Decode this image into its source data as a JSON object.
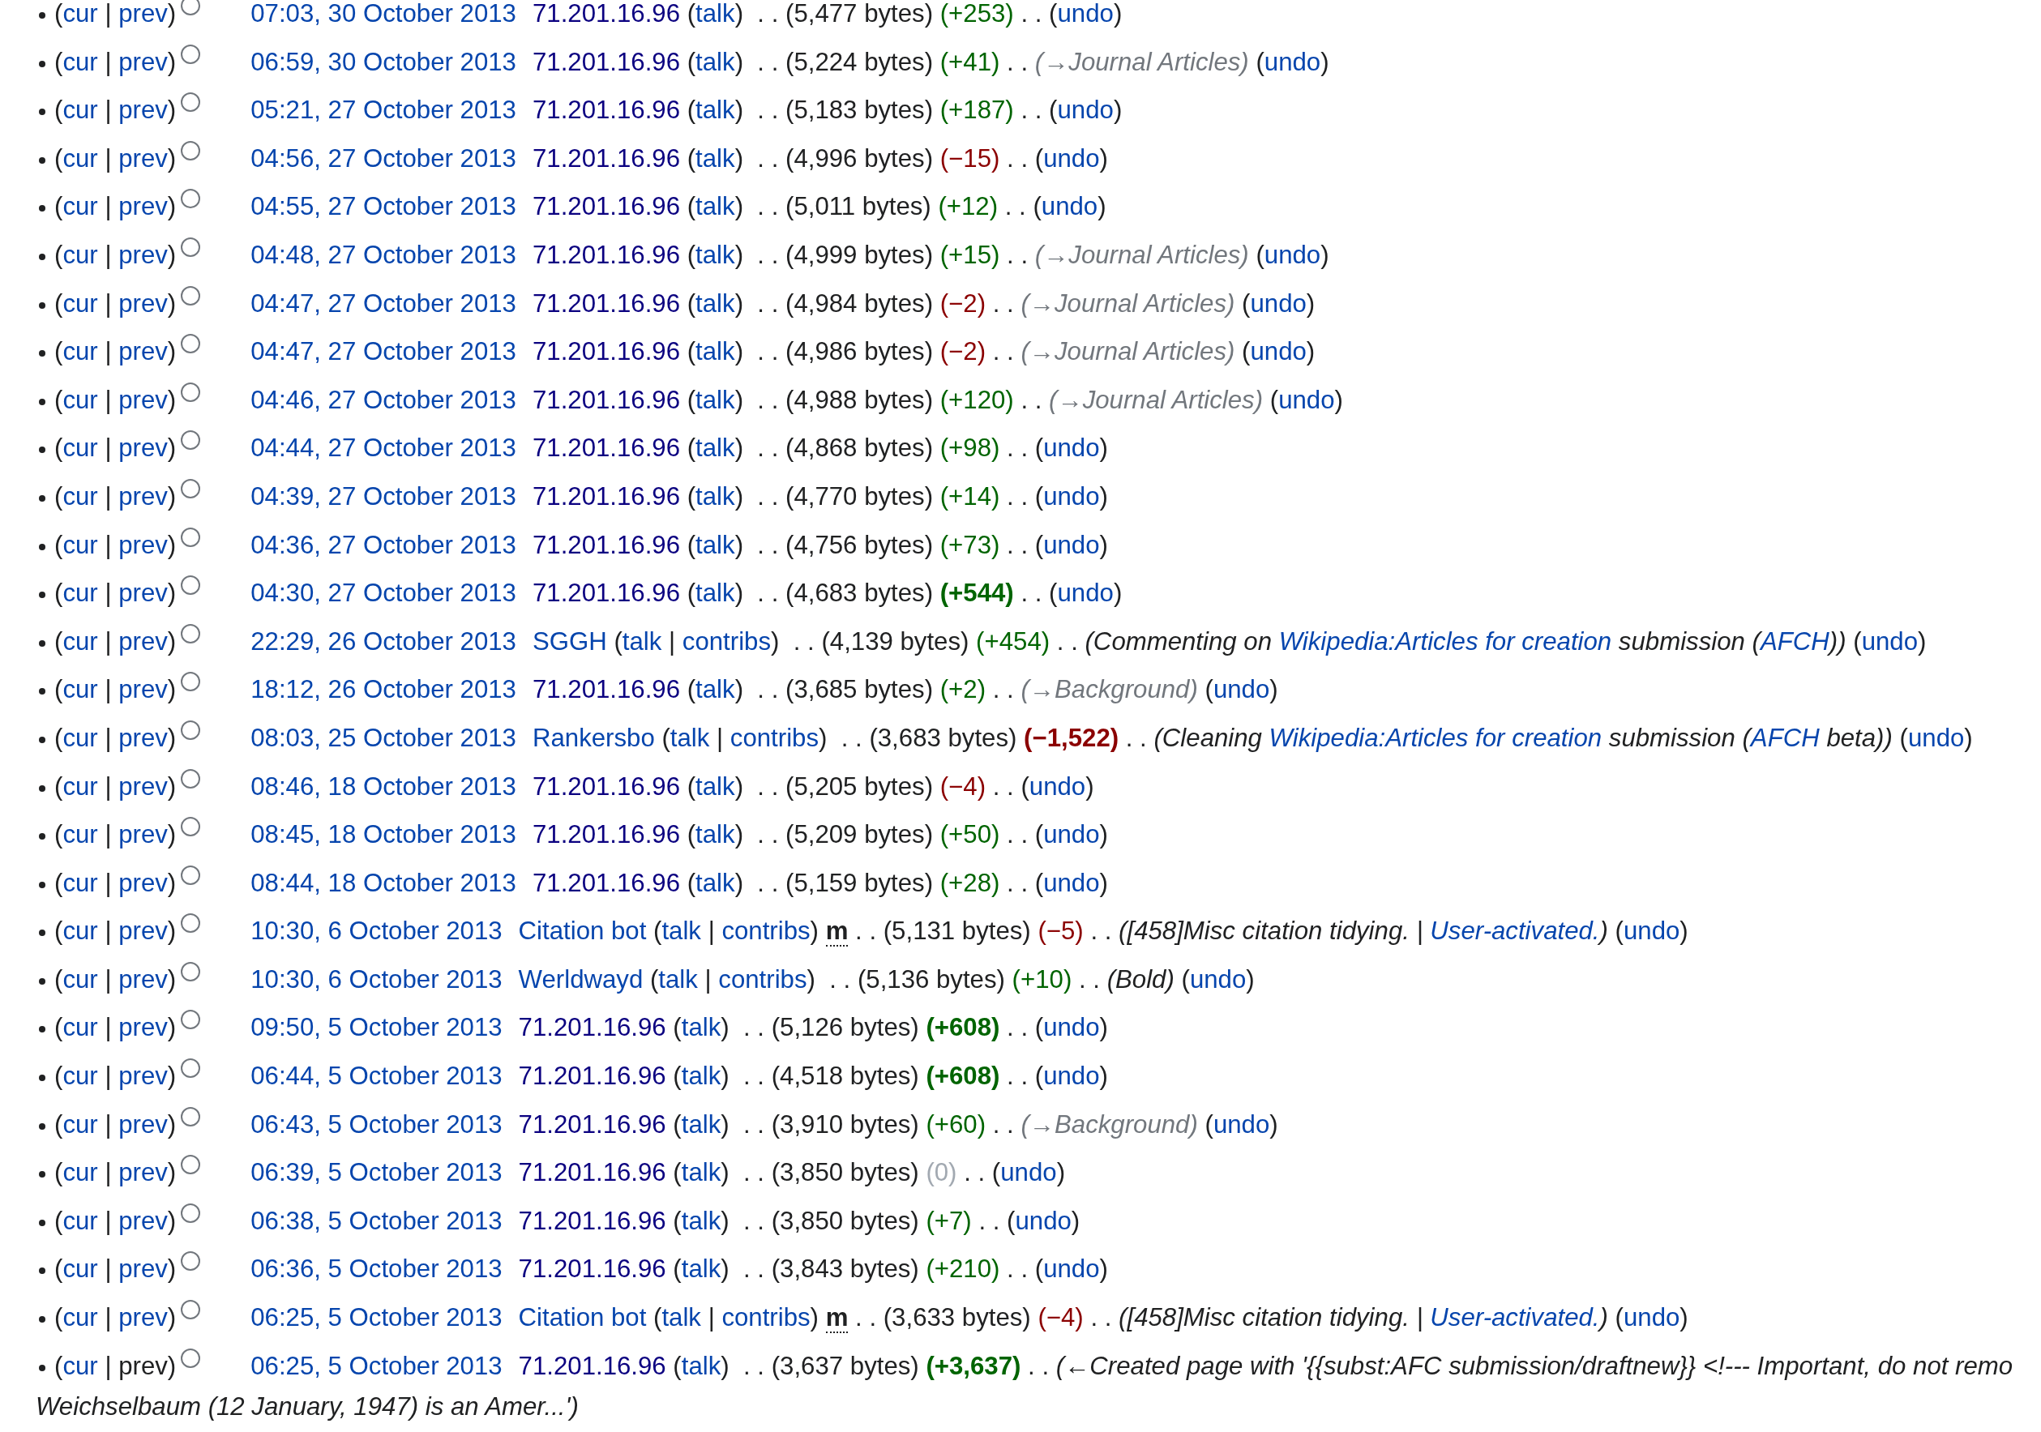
{
  "rows": [
    {
      "selected": false,
      "lead": [
        {
          "kind": "p",
          "text": "("
        },
        {
          "kind": "l",
          "text": "cur"
        },
        {
          "kind": "p",
          "text": " | "
        },
        {
          "kind": "l",
          "text": "prev"
        },
        {
          "kind": "p",
          "text": ")"
        }
      ],
      "parts": [
        {
          "kind": "d",
          "text": "07:03, 30 October 2013"
        },
        {
          "kind": "v",
          "text": "71.201.16.96"
        },
        {
          "kind": "p",
          "text": " ("
        },
        {
          "kind": "l",
          "text": "talk"
        },
        {
          "kind": "p",
          "text": ")  . . (5,477 bytes) "
        },
        {
          "kind": "dp",
          "text": "(+253)"
        },
        {
          "kind": "p",
          "text": " . . ("
        },
        {
          "kind": "l",
          "text": "undo"
        },
        {
          "kind": "p",
          "text": ")"
        }
      ]
    },
    {
      "selected": false,
      "lead": [
        {
          "kind": "p",
          "text": "("
        },
        {
          "kind": "l",
          "text": "cur"
        },
        {
          "kind": "p",
          "text": " | "
        },
        {
          "kind": "l",
          "text": "prev"
        },
        {
          "kind": "p",
          "text": ")"
        }
      ],
      "parts": [
        {
          "kind": "d",
          "text": "06:59, 30 October 2013"
        },
        {
          "kind": "v",
          "text": "71.201.16.96"
        },
        {
          "kind": "p",
          "text": " ("
        },
        {
          "kind": "l",
          "text": "talk"
        },
        {
          "kind": "p",
          "text": ")  . . (5,224 bytes) "
        },
        {
          "kind": "dp",
          "text": "(+41)"
        },
        {
          "kind": "p",
          "text": " . . "
        },
        {
          "kind": "s",
          "text": "(→Journal Articles)"
        },
        {
          "kind": "p",
          "text": " ("
        },
        {
          "kind": "l",
          "text": "undo"
        },
        {
          "kind": "p",
          "text": ")"
        }
      ]
    },
    {
      "selected": false,
      "lead": [
        {
          "kind": "p",
          "text": "("
        },
        {
          "kind": "l",
          "text": "cur"
        },
        {
          "kind": "p",
          "text": " | "
        },
        {
          "kind": "l",
          "text": "prev"
        },
        {
          "kind": "p",
          "text": ")"
        }
      ],
      "parts": [
        {
          "kind": "d",
          "text": "05:21, 27 October 2013"
        },
        {
          "kind": "v",
          "text": "71.201.16.96"
        },
        {
          "kind": "p",
          "text": " ("
        },
        {
          "kind": "l",
          "text": "talk"
        },
        {
          "kind": "p",
          "text": ")  . . (5,183 bytes) "
        },
        {
          "kind": "dp",
          "text": "(+187)"
        },
        {
          "kind": "p",
          "text": " . . ("
        },
        {
          "kind": "l",
          "text": "undo"
        },
        {
          "kind": "p",
          "text": ")"
        }
      ]
    },
    {
      "selected": false,
      "lead": [
        {
          "kind": "p",
          "text": "("
        },
        {
          "kind": "l",
          "text": "cur"
        },
        {
          "kind": "p",
          "text": " | "
        },
        {
          "kind": "l",
          "text": "prev"
        },
        {
          "kind": "p",
          "text": ")"
        }
      ],
      "parts": [
        {
          "kind": "d",
          "text": "04:56, 27 October 2013"
        },
        {
          "kind": "v",
          "text": "71.201.16.96"
        },
        {
          "kind": "p",
          "text": " ("
        },
        {
          "kind": "l",
          "text": "talk"
        },
        {
          "kind": "p",
          "text": ")  . . (4,996 bytes) "
        },
        {
          "kind": "dn",
          "text": "(−15)"
        },
        {
          "kind": "p",
          "text": " . . ("
        },
        {
          "kind": "l",
          "text": "undo"
        },
        {
          "kind": "p",
          "text": ")"
        }
      ]
    },
    {
      "selected": false,
      "lead": [
        {
          "kind": "p",
          "text": "("
        },
        {
          "kind": "l",
          "text": "cur"
        },
        {
          "kind": "p",
          "text": " | "
        },
        {
          "kind": "l",
          "text": "prev"
        },
        {
          "kind": "p",
          "text": ")"
        }
      ],
      "parts": [
        {
          "kind": "d",
          "text": "04:55, 27 October 2013"
        },
        {
          "kind": "v",
          "text": "71.201.16.96"
        },
        {
          "kind": "p",
          "text": " ("
        },
        {
          "kind": "l",
          "text": "talk"
        },
        {
          "kind": "p",
          "text": ")  . . (5,011 bytes) "
        },
        {
          "kind": "dp",
          "text": "(+12)"
        },
        {
          "kind": "p",
          "text": " . . ("
        },
        {
          "kind": "l",
          "text": "undo"
        },
        {
          "kind": "p",
          "text": ")"
        }
      ]
    },
    {
      "selected": false,
      "lead": [
        {
          "kind": "p",
          "text": "("
        },
        {
          "kind": "l",
          "text": "cur"
        },
        {
          "kind": "p",
          "text": " | "
        },
        {
          "kind": "l",
          "text": "prev"
        },
        {
          "kind": "p",
          "text": ")"
        }
      ],
      "parts": [
        {
          "kind": "d",
          "text": "04:48, 27 October 2013"
        },
        {
          "kind": "v",
          "text": "71.201.16.96"
        },
        {
          "kind": "p",
          "text": " ("
        },
        {
          "kind": "l",
          "text": "talk"
        },
        {
          "kind": "p",
          "text": ")  . . (4,999 bytes) "
        },
        {
          "kind": "dp",
          "text": "(+15)"
        },
        {
          "kind": "p",
          "text": " . . "
        },
        {
          "kind": "s",
          "text": "(→Journal Articles)"
        },
        {
          "kind": "p",
          "text": " ("
        },
        {
          "kind": "l",
          "text": "undo"
        },
        {
          "kind": "p",
          "text": ")"
        }
      ]
    },
    {
      "selected": false,
      "lead": [
        {
          "kind": "p",
          "text": "("
        },
        {
          "kind": "l",
          "text": "cur"
        },
        {
          "kind": "p",
          "text": " | "
        },
        {
          "kind": "l",
          "text": "prev"
        },
        {
          "kind": "p",
          "text": ")"
        }
      ],
      "parts": [
        {
          "kind": "d",
          "text": "04:47, 27 October 2013"
        },
        {
          "kind": "v",
          "text": "71.201.16.96"
        },
        {
          "kind": "p",
          "text": " ("
        },
        {
          "kind": "l",
          "text": "talk"
        },
        {
          "kind": "p",
          "text": ")  . . (4,984 bytes) "
        },
        {
          "kind": "dn",
          "text": "(−2)"
        },
        {
          "kind": "p",
          "text": " . . "
        },
        {
          "kind": "s",
          "text": "(→Journal Articles)"
        },
        {
          "kind": "p",
          "text": " ("
        },
        {
          "kind": "l",
          "text": "undo"
        },
        {
          "kind": "p",
          "text": ")"
        }
      ]
    },
    {
      "selected": false,
      "lead": [
        {
          "kind": "p",
          "text": "("
        },
        {
          "kind": "l",
          "text": "cur"
        },
        {
          "kind": "p",
          "text": " | "
        },
        {
          "kind": "l",
          "text": "prev"
        },
        {
          "kind": "p",
          "text": ")"
        }
      ],
      "parts": [
        {
          "kind": "d",
          "text": "04:47, 27 October 2013"
        },
        {
          "kind": "v",
          "text": "71.201.16.96"
        },
        {
          "kind": "p",
          "text": " ("
        },
        {
          "kind": "l",
          "text": "talk"
        },
        {
          "kind": "p",
          "text": ")  . . (4,986 bytes) "
        },
        {
          "kind": "dn",
          "text": "(−2)"
        },
        {
          "kind": "p",
          "text": " . . "
        },
        {
          "kind": "s",
          "text": "(→Journal Articles)"
        },
        {
          "kind": "p",
          "text": " ("
        },
        {
          "kind": "l",
          "text": "undo"
        },
        {
          "kind": "p",
          "text": ")"
        }
      ]
    },
    {
      "selected": false,
      "lead": [
        {
          "kind": "p",
          "text": "("
        },
        {
          "kind": "l",
          "text": "cur"
        },
        {
          "kind": "p",
          "text": " | "
        },
        {
          "kind": "l",
          "text": "prev"
        },
        {
          "kind": "p",
          "text": ")"
        }
      ],
      "parts": [
        {
          "kind": "d",
          "text": "04:46, 27 October 2013"
        },
        {
          "kind": "v",
          "text": "71.201.16.96"
        },
        {
          "kind": "p",
          "text": " ("
        },
        {
          "kind": "l",
          "text": "talk"
        },
        {
          "kind": "p",
          "text": ")  . . (4,988 bytes) "
        },
        {
          "kind": "dp",
          "text": "(+120)"
        },
        {
          "kind": "p",
          "text": " . . "
        },
        {
          "kind": "s",
          "text": "(→Journal Articles)"
        },
        {
          "kind": "p",
          "text": " ("
        },
        {
          "kind": "l",
          "text": "undo"
        },
        {
          "kind": "p",
          "text": ")"
        }
      ]
    },
    {
      "selected": false,
      "lead": [
        {
          "kind": "p",
          "text": "("
        },
        {
          "kind": "l",
          "text": "cur"
        },
        {
          "kind": "p",
          "text": " | "
        },
        {
          "kind": "l",
          "text": "prev"
        },
        {
          "kind": "p",
          "text": ")"
        }
      ],
      "parts": [
        {
          "kind": "d",
          "text": "04:44, 27 October 2013"
        },
        {
          "kind": "v",
          "text": "71.201.16.96"
        },
        {
          "kind": "p",
          "text": " ("
        },
        {
          "kind": "l",
          "text": "talk"
        },
        {
          "kind": "p",
          "text": ")  . . (4,868 bytes) "
        },
        {
          "kind": "dp",
          "text": "(+98)"
        },
        {
          "kind": "p",
          "text": " . . ("
        },
        {
          "kind": "l",
          "text": "undo"
        },
        {
          "kind": "p",
          "text": ")"
        }
      ]
    },
    {
      "selected": false,
      "lead": [
        {
          "kind": "p",
          "text": "("
        },
        {
          "kind": "l",
          "text": "cur"
        },
        {
          "kind": "p",
          "text": " | "
        },
        {
          "kind": "l",
          "text": "prev"
        },
        {
          "kind": "p",
          "text": ")"
        }
      ],
      "parts": [
        {
          "kind": "d",
          "text": "04:39, 27 October 2013"
        },
        {
          "kind": "v",
          "text": "71.201.16.96"
        },
        {
          "kind": "p",
          "text": " ("
        },
        {
          "kind": "l",
          "text": "talk"
        },
        {
          "kind": "p",
          "text": ")  . . (4,770 bytes) "
        },
        {
          "kind": "dp",
          "text": "(+14)"
        },
        {
          "kind": "p",
          "text": " . . ("
        },
        {
          "kind": "l",
          "text": "undo"
        },
        {
          "kind": "p",
          "text": ")"
        }
      ]
    },
    {
      "selected": false,
      "lead": [
        {
          "kind": "p",
          "text": "("
        },
        {
          "kind": "l",
          "text": "cur"
        },
        {
          "kind": "p",
          "text": " | "
        },
        {
          "kind": "l",
          "text": "prev"
        },
        {
          "kind": "p",
          "text": ")"
        }
      ],
      "parts": [
        {
          "kind": "d",
          "text": "04:36, 27 October 2013"
        },
        {
          "kind": "v",
          "text": "71.201.16.96"
        },
        {
          "kind": "p",
          "text": " ("
        },
        {
          "kind": "l",
          "text": "talk"
        },
        {
          "kind": "p",
          "text": ")  . . (4,756 bytes) "
        },
        {
          "kind": "dp",
          "text": "(+73)"
        },
        {
          "kind": "p",
          "text": " . . ("
        },
        {
          "kind": "l",
          "text": "undo"
        },
        {
          "kind": "p",
          "text": ")"
        }
      ]
    },
    {
      "selected": false,
      "lead": [
        {
          "kind": "p",
          "text": "("
        },
        {
          "kind": "l",
          "text": "cur"
        },
        {
          "kind": "p",
          "text": " | "
        },
        {
          "kind": "l",
          "text": "prev"
        },
        {
          "kind": "p",
          "text": ")"
        }
      ],
      "parts": [
        {
          "kind": "d",
          "text": "04:30, 27 October 2013"
        },
        {
          "kind": "v",
          "text": "71.201.16.96"
        },
        {
          "kind": "p",
          "text": " ("
        },
        {
          "kind": "l",
          "text": "talk"
        },
        {
          "kind": "p",
          "text": ")  . . (4,683 bytes) "
        },
        {
          "kind": "dpb",
          "text": "(+544)"
        },
        {
          "kind": "p",
          "text": " . . ("
        },
        {
          "kind": "l",
          "text": "undo"
        },
        {
          "kind": "p",
          "text": ")"
        }
      ]
    },
    {
      "selected": false,
      "lead": [
        {
          "kind": "p",
          "text": "("
        },
        {
          "kind": "l",
          "text": "cur"
        },
        {
          "kind": "p",
          "text": " | "
        },
        {
          "kind": "l",
          "text": "prev"
        },
        {
          "kind": "p",
          "text": ")"
        }
      ],
      "parts": [
        {
          "kind": "d",
          "text": "22:29, 26 October 2013"
        },
        {
          "kind": "l",
          "text": "SGGH"
        },
        {
          "kind": "p",
          "text": " ("
        },
        {
          "kind": "l",
          "text": "talk"
        },
        {
          "kind": "p",
          "text": " | "
        },
        {
          "kind": "l",
          "text": "contribs"
        },
        {
          "kind": "p",
          "text": ")  . . (4,139 bytes) "
        },
        {
          "kind": "dp",
          "text": "(+454)"
        },
        {
          "kind": "p",
          "text": " . . "
        },
        {
          "kind": "i",
          "text": "(Commenting on "
        },
        {
          "kind": "il",
          "text": "Wikipedia:Articles for creation"
        },
        {
          "kind": "i",
          "text": " submission ("
        },
        {
          "kind": "il",
          "text": "AFCH"
        },
        {
          "kind": "i",
          "text": "))"
        },
        {
          "kind": "p",
          "text": " ("
        },
        {
          "kind": "l",
          "text": "undo"
        },
        {
          "kind": "p",
          "text": ")"
        }
      ]
    },
    {
      "selected": false,
      "lead": [
        {
          "kind": "p",
          "text": "("
        },
        {
          "kind": "l",
          "text": "cur"
        },
        {
          "kind": "p",
          "text": " | "
        },
        {
          "kind": "l",
          "text": "prev"
        },
        {
          "kind": "p",
          "text": ")"
        }
      ],
      "parts": [
        {
          "kind": "d",
          "text": "18:12, 26 October 2013"
        },
        {
          "kind": "v",
          "text": "71.201.16.96"
        },
        {
          "kind": "p",
          "text": " ("
        },
        {
          "kind": "l",
          "text": "talk"
        },
        {
          "kind": "p",
          "text": ")  . . (3,685 bytes) "
        },
        {
          "kind": "dp",
          "text": "(+2)"
        },
        {
          "kind": "p",
          "text": " . . "
        },
        {
          "kind": "s",
          "text": "(→Background)"
        },
        {
          "kind": "p",
          "text": " ("
        },
        {
          "kind": "l",
          "text": "undo"
        },
        {
          "kind": "p",
          "text": ")"
        }
      ]
    },
    {
      "selected": false,
      "lead": [
        {
          "kind": "p",
          "text": "("
        },
        {
          "kind": "l",
          "text": "cur"
        },
        {
          "kind": "p",
          "text": " | "
        },
        {
          "kind": "l",
          "text": "prev"
        },
        {
          "kind": "p",
          "text": ")"
        }
      ],
      "parts": [
        {
          "kind": "d",
          "text": "08:03, 25 October 2013"
        },
        {
          "kind": "l",
          "text": "Rankersbo"
        },
        {
          "kind": "p",
          "text": " ("
        },
        {
          "kind": "l",
          "text": "talk"
        },
        {
          "kind": "p",
          "text": " | "
        },
        {
          "kind": "l",
          "text": "contribs"
        },
        {
          "kind": "p",
          "text": ")  . . (3,683 bytes) "
        },
        {
          "kind": "dnb",
          "text": "(−1,522)"
        },
        {
          "kind": "p",
          "text": " . . "
        },
        {
          "kind": "i",
          "text": "(Cleaning "
        },
        {
          "kind": "il",
          "text": "Wikipedia:Articles for creation"
        },
        {
          "kind": "i",
          "text": " submission ("
        },
        {
          "kind": "il",
          "text": "AFCH"
        },
        {
          "kind": "i",
          "text": " beta))"
        },
        {
          "kind": "p",
          "text": " ("
        },
        {
          "kind": "l",
          "text": "undo"
        },
        {
          "kind": "p",
          "text": ")"
        }
      ]
    },
    {
      "selected": false,
      "lead": [
        {
          "kind": "p",
          "text": "("
        },
        {
          "kind": "l",
          "text": "cur"
        },
        {
          "kind": "p",
          "text": " | "
        },
        {
          "kind": "l",
          "text": "prev"
        },
        {
          "kind": "p",
          "text": ")"
        }
      ],
      "parts": [
        {
          "kind": "d",
          "text": "08:46, 18 October 2013"
        },
        {
          "kind": "v",
          "text": "71.201.16.96"
        },
        {
          "kind": "p",
          "text": " ("
        },
        {
          "kind": "l",
          "text": "talk"
        },
        {
          "kind": "p",
          "text": ")  . . (5,205 bytes) "
        },
        {
          "kind": "dn",
          "text": "(−4)"
        },
        {
          "kind": "p",
          "text": " . . ("
        },
        {
          "kind": "l",
          "text": "undo"
        },
        {
          "kind": "p",
          "text": ")"
        }
      ]
    },
    {
      "selected": false,
      "lead": [
        {
          "kind": "p",
          "text": "("
        },
        {
          "kind": "l",
          "text": "cur"
        },
        {
          "kind": "p",
          "text": " | "
        },
        {
          "kind": "l",
          "text": "prev"
        },
        {
          "kind": "p",
          "text": ")"
        }
      ],
      "parts": [
        {
          "kind": "d",
          "text": "08:45, 18 October 2013"
        },
        {
          "kind": "v",
          "text": "71.201.16.96"
        },
        {
          "kind": "p",
          "text": " ("
        },
        {
          "kind": "l",
          "text": "talk"
        },
        {
          "kind": "p",
          "text": ")  . . (5,209 bytes) "
        },
        {
          "kind": "dp",
          "text": "(+50)"
        },
        {
          "kind": "p",
          "text": " . . ("
        },
        {
          "kind": "l",
          "text": "undo"
        },
        {
          "kind": "p",
          "text": ")"
        }
      ]
    },
    {
      "selected": false,
      "lead": [
        {
          "kind": "p",
          "text": "("
        },
        {
          "kind": "l",
          "text": "cur"
        },
        {
          "kind": "p",
          "text": " | "
        },
        {
          "kind": "l",
          "text": "prev"
        },
        {
          "kind": "p",
          "text": ")"
        }
      ],
      "parts": [
        {
          "kind": "d",
          "text": "08:44, 18 October 2013"
        },
        {
          "kind": "v",
          "text": "71.201.16.96"
        },
        {
          "kind": "p",
          "text": " ("
        },
        {
          "kind": "l",
          "text": "talk"
        },
        {
          "kind": "p",
          "text": ")  . . (5,159 bytes) "
        },
        {
          "kind": "dp",
          "text": "(+28)"
        },
        {
          "kind": "p",
          "text": " . . ("
        },
        {
          "kind": "l",
          "text": "undo"
        },
        {
          "kind": "p",
          "text": ")"
        }
      ]
    },
    {
      "selected": false,
      "lead": [
        {
          "kind": "p",
          "text": "("
        },
        {
          "kind": "l",
          "text": "cur"
        },
        {
          "kind": "p",
          "text": " | "
        },
        {
          "kind": "l",
          "text": "prev"
        },
        {
          "kind": "p",
          "text": ")"
        }
      ],
      "parts": [
        {
          "kind": "d",
          "text": "10:30, 6 October 2013"
        },
        {
          "kind": "l",
          "text": "Citation bot"
        },
        {
          "kind": "p",
          "text": " ("
        },
        {
          "kind": "l",
          "text": "talk"
        },
        {
          "kind": "p",
          "text": " | "
        },
        {
          "kind": "l",
          "text": "contribs"
        },
        {
          "kind": "p",
          "text": ") "
        },
        {
          "kind": "m",
          "text": "m"
        },
        {
          "kind": "p",
          "text": " . . (5,131 bytes) "
        },
        {
          "kind": "dn",
          "text": "(−5)"
        },
        {
          "kind": "p",
          "text": " . . "
        },
        {
          "kind": "i",
          "text": "([458]Misc citation tidying. | "
        },
        {
          "kind": "il",
          "text": "User-activated."
        },
        {
          "kind": "i",
          "text": ")"
        },
        {
          "kind": "p",
          "text": " ("
        },
        {
          "kind": "l",
          "text": "undo"
        },
        {
          "kind": "p",
          "text": ")"
        }
      ]
    },
    {
      "selected": false,
      "lead": [
        {
          "kind": "p",
          "text": "("
        },
        {
          "kind": "l",
          "text": "cur"
        },
        {
          "kind": "p",
          "text": " | "
        },
        {
          "kind": "l",
          "text": "prev"
        },
        {
          "kind": "p",
          "text": ")"
        }
      ],
      "parts": [
        {
          "kind": "d",
          "text": "10:30, 6 October 2013"
        },
        {
          "kind": "l",
          "text": "Werldwayd"
        },
        {
          "kind": "p",
          "text": " ("
        },
        {
          "kind": "l",
          "text": "talk"
        },
        {
          "kind": "p",
          "text": " | "
        },
        {
          "kind": "l",
          "text": "contribs"
        },
        {
          "kind": "p",
          "text": ")  . . (5,136 bytes) "
        },
        {
          "kind": "dp",
          "text": "(+10)"
        },
        {
          "kind": "p",
          "text": " . . "
        },
        {
          "kind": "i",
          "text": "(Bold)"
        },
        {
          "kind": "p",
          "text": " ("
        },
        {
          "kind": "l",
          "text": "undo"
        },
        {
          "kind": "p",
          "text": ")"
        }
      ]
    },
    {
      "selected": false,
      "lead": [
        {
          "kind": "p",
          "text": "("
        },
        {
          "kind": "l",
          "text": "cur"
        },
        {
          "kind": "p",
          "text": " | "
        },
        {
          "kind": "l",
          "text": "prev"
        },
        {
          "kind": "p",
          "text": ")"
        }
      ],
      "parts": [
        {
          "kind": "d",
          "text": "09:50, 5 October 2013"
        },
        {
          "kind": "v",
          "text": "71.201.16.96"
        },
        {
          "kind": "p",
          "text": " ("
        },
        {
          "kind": "l",
          "text": "talk"
        },
        {
          "kind": "p",
          "text": ")  . . (5,126 bytes) "
        },
        {
          "kind": "dpb",
          "text": "(+608)"
        },
        {
          "kind": "p",
          "text": " . . ("
        },
        {
          "kind": "l",
          "text": "undo"
        },
        {
          "kind": "p",
          "text": ")"
        }
      ]
    },
    {
      "selected": false,
      "lead": [
        {
          "kind": "p",
          "text": "("
        },
        {
          "kind": "l",
          "text": "cur"
        },
        {
          "kind": "p",
          "text": " | "
        },
        {
          "kind": "l",
          "text": "prev"
        },
        {
          "kind": "p",
          "text": ")"
        }
      ],
      "parts": [
        {
          "kind": "d",
          "text": "06:44, 5 October 2013"
        },
        {
          "kind": "v",
          "text": "71.201.16.96"
        },
        {
          "kind": "p",
          "text": " ("
        },
        {
          "kind": "l",
          "text": "talk"
        },
        {
          "kind": "p",
          "text": ")  . . (4,518 bytes) "
        },
        {
          "kind": "dpb",
          "text": "(+608)"
        },
        {
          "kind": "p",
          "text": " . . ("
        },
        {
          "kind": "l",
          "text": "undo"
        },
        {
          "kind": "p",
          "text": ")"
        }
      ]
    },
    {
      "selected": false,
      "lead": [
        {
          "kind": "p",
          "text": "("
        },
        {
          "kind": "l",
          "text": "cur"
        },
        {
          "kind": "p",
          "text": " | "
        },
        {
          "kind": "l",
          "text": "prev"
        },
        {
          "kind": "p",
          "text": ")"
        }
      ],
      "parts": [
        {
          "kind": "d",
          "text": "06:43, 5 October 2013"
        },
        {
          "kind": "v",
          "text": "71.201.16.96"
        },
        {
          "kind": "p",
          "text": " ("
        },
        {
          "kind": "l",
          "text": "talk"
        },
        {
          "kind": "p",
          "text": ")  . . (3,910 bytes) "
        },
        {
          "kind": "dp",
          "text": "(+60)"
        },
        {
          "kind": "p",
          "text": " . . "
        },
        {
          "kind": "s",
          "text": "(→Background)"
        },
        {
          "kind": "p",
          "text": " ("
        },
        {
          "kind": "l",
          "text": "undo"
        },
        {
          "kind": "p",
          "text": ")"
        }
      ]
    },
    {
      "selected": false,
      "lead": [
        {
          "kind": "p",
          "text": "("
        },
        {
          "kind": "l",
          "text": "cur"
        },
        {
          "kind": "p",
          "text": " | "
        },
        {
          "kind": "l",
          "text": "prev"
        },
        {
          "kind": "p",
          "text": ")"
        }
      ],
      "parts": [
        {
          "kind": "d",
          "text": "06:39, 5 October 2013"
        },
        {
          "kind": "v",
          "text": "71.201.16.96"
        },
        {
          "kind": "p",
          "text": " ("
        },
        {
          "kind": "l",
          "text": "talk"
        },
        {
          "kind": "p",
          "text": ")  . . (3,850 bytes) "
        },
        {
          "kind": "dz",
          "text": "(0)"
        },
        {
          "kind": "p",
          "text": " . . ("
        },
        {
          "kind": "l",
          "text": "undo"
        },
        {
          "kind": "p",
          "text": ")"
        }
      ]
    },
    {
      "selected": false,
      "lead": [
        {
          "kind": "p",
          "text": "("
        },
        {
          "kind": "l",
          "text": "cur"
        },
        {
          "kind": "p",
          "text": " | "
        },
        {
          "kind": "l",
          "text": "prev"
        },
        {
          "kind": "p",
          "text": ")"
        }
      ],
      "parts": [
        {
          "kind": "d",
          "text": "06:38, 5 October 2013"
        },
        {
          "kind": "v",
          "text": "71.201.16.96"
        },
        {
          "kind": "p",
          "text": " ("
        },
        {
          "kind": "l",
          "text": "talk"
        },
        {
          "kind": "p",
          "text": ")  . . (3,850 bytes) "
        },
        {
          "kind": "dp",
          "text": "(+7)"
        },
        {
          "kind": "p",
          "text": " . . ("
        },
        {
          "kind": "l",
          "text": "undo"
        },
        {
          "kind": "p",
          "text": ")"
        }
      ]
    },
    {
      "selected": false,
      "lead": [
        {
          "kind": "p",
          "text": "("
        },
        {
          "kind": "l",
          "text": "cur"
        },
        {
          "kind": "p",
          "text": " | "
        },
        {
          "kind": "l",
          "text": "prev"
        },
        {
          "kind": "p",
          "text": ")"
        }
      ],
      "parts": [
        {
          "kind": "d",
          "text": "06:36, 5 October 2013"
        },
        {
          "kind": "v",
          "text": "71.201.16.96"
        },
        {
          "kind": "p",
          "text": " ("
        },
        {
          "kind": "l",
          "text": "talk"
        },
        {
          "kind": "p",
          "text": ")  . . (3,843 bytes) "
        },
        {
          "kind": "dp",
          "text": "(+210)"
        },
        {
          "kind": "p",
          "text": " . . ("
        },
        {
          "kind": "l",
          "text": "undo"
        },
        {
          "kind": "p",
          "text": ")"
        }
      ]
    },
    {
      "selected": false,
      "lead": [
        {
          "kind": "p",
          "text": "("
        },
        {
          "kind": "l",
          "text": "cur"
        },
        {
          "kind": "p",
          "text": " | "
        },
        {
          "kind": "l",
          "text": "prev"
        },
        {
          "kind": "p",
          "text": ")"
        }
      ],
      "parts": [
        {
          "kind": "d",
          "text": "06:25, 5 October 2013"
        },
        {
          "kind": "l",
          "text": "Citation bot"
        },
        {
          "kind": "p",
          "text": " ("
        },
        {
          "kind": "l",
          "text": "talk"
        },
        {
          "kind": "p",
          "text": " | "
        },
        {
          "kind": "l",
          "text": "contribs"
        },
        {
          "kind": "p",
          "text": ") "
        },
        {
          "kind": "m",
          "text": "m"
        },
        {
          "kind": "p",
          "text": " . . (3,633 bytes) "
        },
        {
          "kind": "dn",
          "text": "(−4)"
        },
        {
          "kind": "p",
          "text": " . . "
        },
        {
          "kind": "i",
          "text": "([458]Misc citation tidying. | "
        },
        {
          "kind": "il",
          "text": "User-activated."
        },
        {
          "kind": "i",
          "text": ")"
        },
        {
          "kind": "p",
          "text": " ("
        },
        {
          "kind": "l",
          "text": "undo"
        },
        {
          "kind": "p",
          "text": ")"
        }
      ]
    },
    {
      "selected": false,
      "lead": [
        {
          "kind": "p",
          "text": "("
        },
        {
          "kind": "l",
          "text": "cur"
        },
        {
          "kind": "p",
          "text": " | prev)"
        }
      ],
      "parts": [
        {
          "kind": "d",
          "text": "06:25, 5 October 2013"
        },
        {
          "kind": "v",
          "text": "71.201.16.96"
        },
        {
          "kind": "p",
          "text": " ("
        },
        {
          "kind": "l",
          "text": "talk"
        },
        {
          "kind": "p",
          "text": ")  . . (3,637 bytes) "
        },
        {
          "kind": "dpb",
          "text": "(+3,637)"
        },
        {
          "kind": "p",
          "text": " . . "
        },
        {
          "kind": "i",
          "text": "(←Created page with '{{subst:AFC submission/draftnew}} <!--- Important, do not remo"
        },
        {
          "kind": "iw",
          "text": "Weichselbaum (12 January, 1947) is an Amer...')"
        }
      ]
    }
  ]
}
